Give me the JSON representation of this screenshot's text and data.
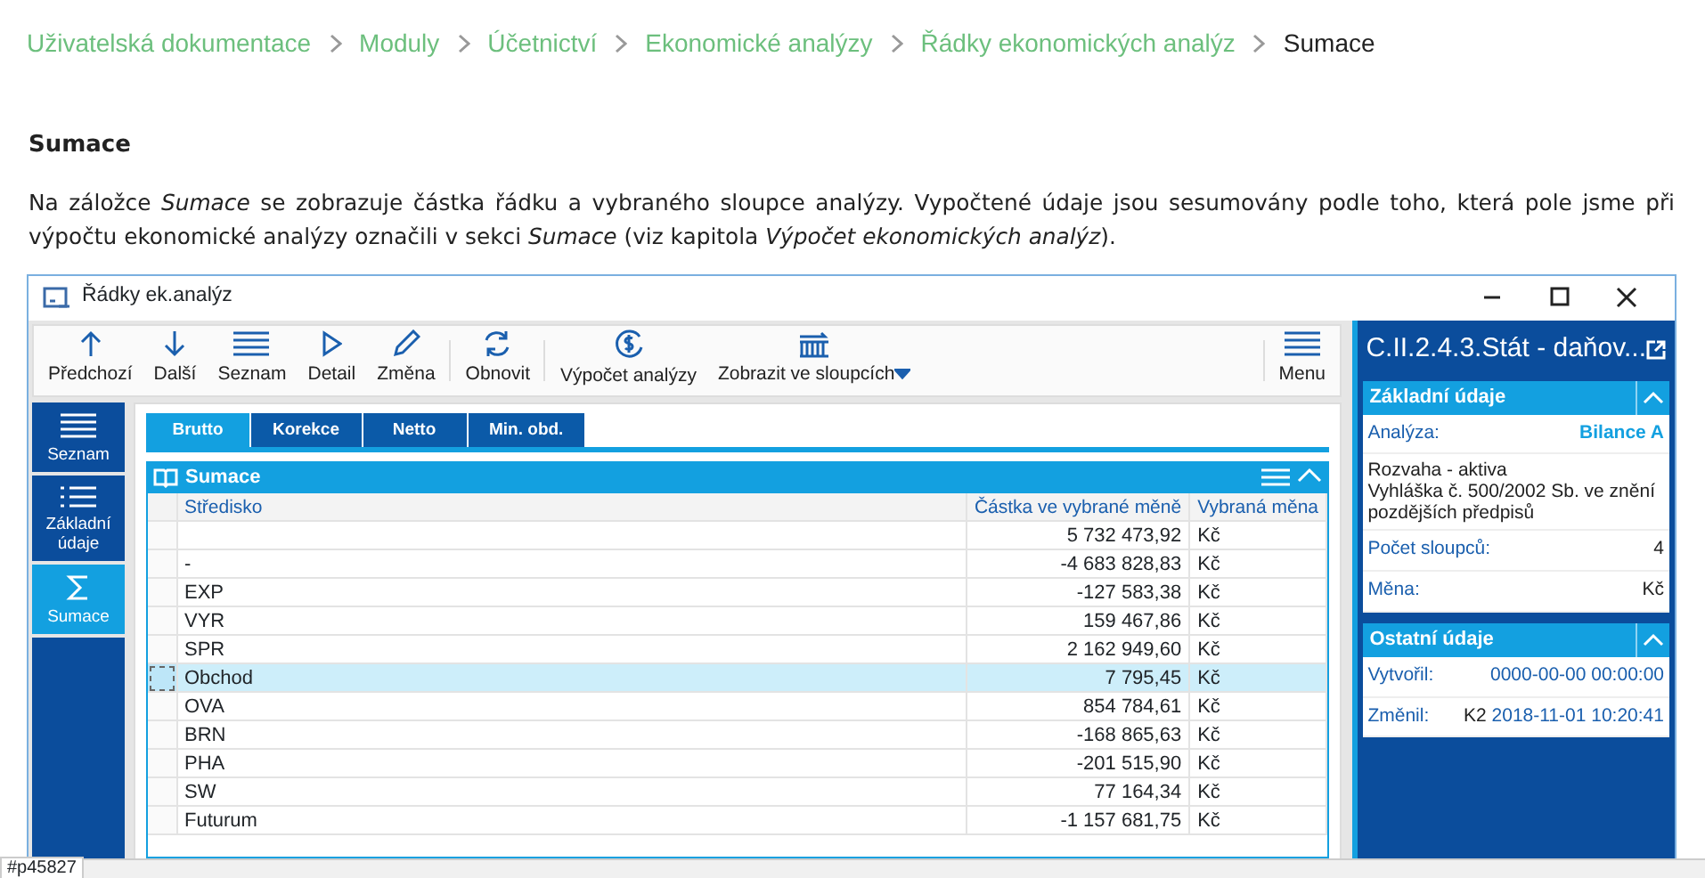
{
  "breadcrumb": [
    {
      "label": "Uživatelská dokumentace",
      "current": false
    },
    {
      "label": "Moduly",
      "current": false
    },
    {
      "label": "Účetnictví",
      "current": false
    },
    {
      "label": "Ekonomické analýzy",
      "current": false
    },
    {
      "label": "Řádky ekonomických analýz",
      "current": false
    },
    {
      "label": "Sumace",
      "current": true
    }
  ],
  "heading": "Sumace",
  "paragraph": "Na záložce *Sumace* se zobrazuje částka řádku a vybraného sloupce analýzy. Vypočtené údaje jsou sesumovány podle toho, která pole jsme při výpočtu ekonomické analýzy označili v sekci *Sumace* (viz kapitola *Výpočet ekonomických analýz*).",
  "window": {
    "title": "Řádky ek.analýz",
    "toolbar": [
      {
        "kind": "up",
        "label": "Předchozí"
      },
      {
        "kind": "down",
        "label": "Další"
      },
      {
        "kind": "list",
        "label": "Seznam"
      },
      {
        "kind": "play",
        "label": "Detail"
      },
      {
        "kind": "pencil",
        "label": "Změna",
        "sep": true
      },
      {
        "kind": "refresh",
        "label": "Obnovit",
        "sep": true
      },
      {
        "kind": "money",
        "label": "Výpočet analýzy"
      },
      {
        "kind": "columns",
        "label": "Zobrazit ve sloupcích",
        "dropdown": true
      }
    ],
    "menu_button": "Menu",
    "sidebar": [
      {
        "kind": "list",
        "label": "Seznam",
        "selected": false
      },
      {
        "kind": "list2",
        "label": "Základní údaje",
        "selected": false
      },
      {
        "kind": "sigma",
        "label": "Sumace",
        "selected": true
      }
    ],
    "tabs": [
      {
        "label": "Brutto",
        "selected": true
      },
      {
        "label": "Korekce",
        "selected": false
      },
      {
        "label": "Netto",
        "selected": false
      },
      {
        "label": "Min. obd.",
        "selected": false
      }
    ],
    "grid": {
      "title": "Sumace",
      "columns": [
        "Středisko",
        "Částka ve vybrané měně",
        "Vybraná měna"
      ],
      "rows": [
        {
          "cells": [
            "",
            "5 732 473,92",
            "Kč"
          ],
          "selected": false
        },
        {
          "cells": [
            "-",
            "-4 683 828,83",
            "Kč"
          ],
          "selected": false
        },
        {
          "cells": [
            "EXP",
            "-127 583,38",
            "Kč"
          ],
          "selected": false
        },
        {
          "cells": [
            "VYR",
            "159 467,86",
            "Kč"
          ],
          "selected": false
        },
        {
          "cells": [
            "SPR",
            "2 162 949,60",
            "Kč"
          ],
          "selected": false
        },
        {
          "cells": [
            "Obchod",
            "7 795,45",
            "Kč"
          ],
          "selected": true
        },
        {
          "cells": [
            "OVA",
            "854 784,61",
            "Kč"
          ],
          "selected": false
        },
        {
          "cells": [
            "BRN",
            "-168 865,63",
            "Kč"
          ],
          "selected": false
        },
        {
          "cells": [
            "PHA",
            "-201 515,90",
            "Kč"
          ],
          "selected": false
        },
        {
          "cells": [
            "SW",
            "77 164,34",
            "Kč"
          ],
          "selected": false
        },
        {
          "cells": [
            "Futurum",
            "-1 157 681,75",
            "Kč"
          ],
          "selected": false
        }
      ]
    },
    "detail": {
      "title": "C.II.2.4.3.Stát - daňov...",
      "sections": [
        {
          "title": "Základní údaje",
          "expanded": true,
          "items": [
            {
              "kind": "field",
              "label": "Analýza:",
              "value": "Bilance A",
              "link": true
            },
            {
              "kind": "text",
              "lines": [
                "Rozvaha - aktiva",
                "Vyhláška č. 500/2002 Sb. ve znění pozdějších předpisů"
              ]
            },
            {
              "kind": "field",
              "label": "Počet sloupců:",
              "value": "4",
              "link": false
            },
            {
              "kind": "field",
              "label": "Měna:",
              "value": "Kč",
              "link": false
            }
          ]
        },
        {
          "title": "Ostatní údaje",
          "expanded": true,
          "items": [
            {
              "kind": "field",
              "label": "Vytvořil:",
              "value": "0000-00-00 00:00:00",
              "link": true
            },
            {
              "kind": "field",
              "label": "Změnil:",
              "user": "K2",
              "value": "2018-11-01 10:20:41",
              "link": true
            }
          ]
        }
      ]
    }
  },
  "status_url": "#p45827"
}
